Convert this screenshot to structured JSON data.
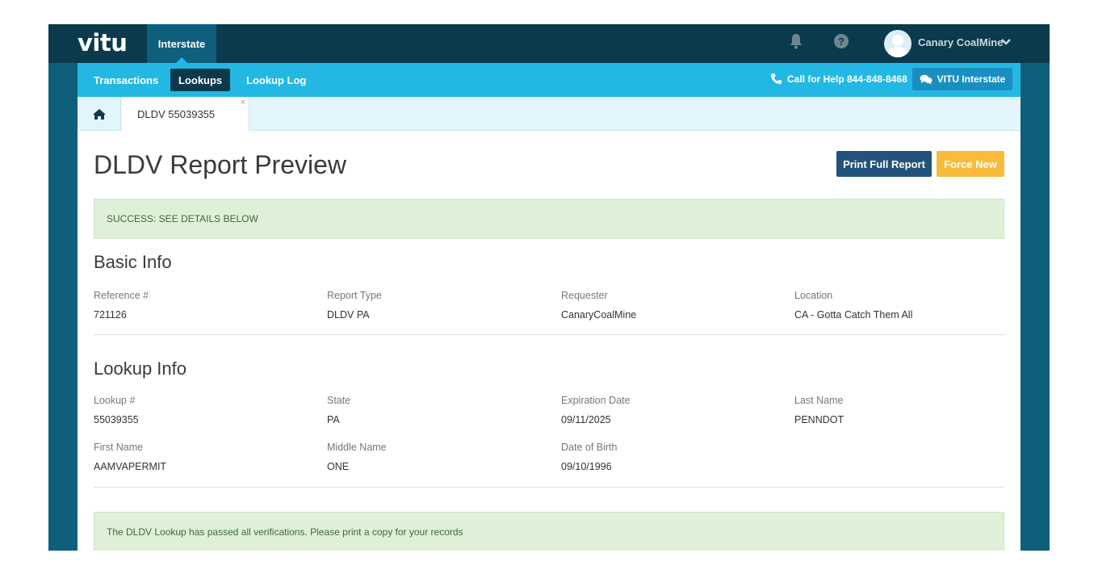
{
  "header": {
    "logo": "vitu",
    "active_app": "Interstate",
    "user_name": "Canary CoalMine"
  },
  "subnav": {
    "items": [
      {
        "label": "Transactions",
        "active": false
      },
      {
        "label": "Lookups",
        "active": true
      },
      {
        "label": "Lookup Log",
        "active": false
      }
    ],
    "call_help": "Call for Help 844-848-8468",
    "chat_button": "VITU Interstate"
  },
  "tabs": {
    "open_tab": "DLDV 55039355",
    "close_glyph": "×"
  },
  "page": {
    "title": "DLDV Report Preview",
    "print_button": "Print Full Report",
    "force_button": "Force New",
    "success_alert": "SUCCESS: SEE DETAILS BELOW",
    "passed_alert": "The DLDV Lookup has passed all verifications. Please print a copy for your records"
  },
  "basic_info": {
    "title": "Basic Info",
    "fields": [
      {
        "label": "Reference #",
        "value": "721126"
      },
      {
        "label": "Report Type",
        "value": "DLDV PA"
      },
      {
        "label": "Requester",
        "value": "CanaryCoalMine"
      },
      {
        "label": "Location",
        "value": "CA - Gotta Catch Them All"
      }
    ]
  },
  "lookup_info": {
    "title": "Lookup Info",
    "fields": [
      {
        "label": "Lookup #",
        "value": "55039355"
      },
      {
        "label": "State",
        "value": "PA"
      },
      {
        "label": "Expiration Date",
        "value": "09/11/2025"
      },
      {
        "label": "Last Name",
        "value": "PENNDOT"
      },
      {
        "label": "First Name",
        "value": "AAMVAPERMIT"
      },
      {
        "label": "Middle Name",
        "value": "ONE"
      },
      {
        "label": "Date of Birth",
        "value": "09/10/1996"
      }
    ]
  },
  "colors": {
    "topbar": "#0b3a4d",
    "subnav": "#23b8e4",
    "primary_button": "#23537a",
    "warning_button": "#f8bb3c",
    "success_bg": "#dff0d8"
  }
}
